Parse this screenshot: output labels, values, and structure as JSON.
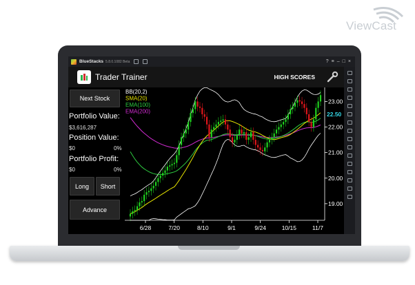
{
  "watermark": {
    "brand": "ViewCast"
  },
  "bluestacks": {
    "title": "BlueStacks",
    "version": "5.8.0.1082 Beta"
  },
  "app": {
    "title": "Trader Trainer",
    "high_scores_label": "HIGH SCORES"
  },
  "panel": {
    "next_stock_label": "Next Stock",
    "portfolio_value_label": "Portfolio Value:",
    "portfolio_value": "$3,616,287",
    "position_value_label": "Position Value:",
    "position_value": "$0",
    "position_pct": "0%",
    "portfolio_profit_label": "Portfolio Profit:",
    "portfolio_profit": "$0",
    "profit_pct": "0%",
    "long_label": "Long",
    "short_label": "Short",
    "advance_label": "Advance"
  },
  "legend": [
    {
      "label": "BB(20,2)",
      "color": "#ffffff"
    },
    {
      "label": "SMA(20)",
      "color": "#e8e600"
    },
    {
      "label": "EMA(100)",
      "color": "#2ecc40"
    },
    {
      "label": "EMA(200)",
      "color": "#d22bd2"
    }
  ],
  "chart_data": {
    "type": "line",
    "x_tick_labels": [
      "6/28",
      "7/20",
      "8/10",
      "9/1",
      "9/24",
      "10/15",
      "11/7"
    ],
    "y_tick_values": [
      19.0,
      20.0,
      21.0,
      22.0,
      23.0
    ],
    "y_tick_labels": [
      "19.00",
      "20.00",
      "21.00",
      "22.00",
      "23.00"
    ],
    "current_price": 22.5,
    "current_price_label": "22.50",
    "ylim": [
      18.35,
      23.55
    ],
    "close": [
      18.6,
      18.7,
      18.75,
      18.9,
      19.05,
      19.1,
      19.35,
      19.45,
      19.5,
      19.6,
      19.7,
      19.85,
      20.0,
      20.1,
      20.2,
      20.3,
      20.45,
      20.5,
      20.55,
      20.6,
      20.9,
      21.3,
      21.6,
      21.75,
      21.9,
      22.2,
      22.55,
      22.7,
      23.0,
      22.8,
      22.75,
      22.5,
      22.4,
      22.1,
      21.6,
      21.9,
      22.0,
      22.1,
      22.2,
      22.25,
      22.3,
      22.1,
      21.9,
      21.6,
      21.4,
      21.5,
      21.7,
      21.9,
      21.75,
      21.8,
      21.5,
      21.6,
      21.8,
      21.5,
      21.3,
      21.2,
      21.1,
      21.05,
      21.2,
      21.4,
      21.5,
      21.6,
      21.75,
      21.9,
      22.0,
      22.1,
      22.2,
      22.3,
      22.5,
      22.7,
      22.8,
      22.95,
      23.05,
      23.0,
      22.9,
      22.75,
      22.5,
      22.2,
      22.0,
      22.3,
      22.75,
      23.0,
      23.25
    ],
    "colors": {
      "up": "#1fd11f",
      "down": "#e0161b",
      "bb": "#ffffff",
      "sma20": "#e8e600",
      "ema100": "#2ecc40",
      "ema200": "#d22bd2",
      "price_label": "#35d7e6"
    }
  }
}
